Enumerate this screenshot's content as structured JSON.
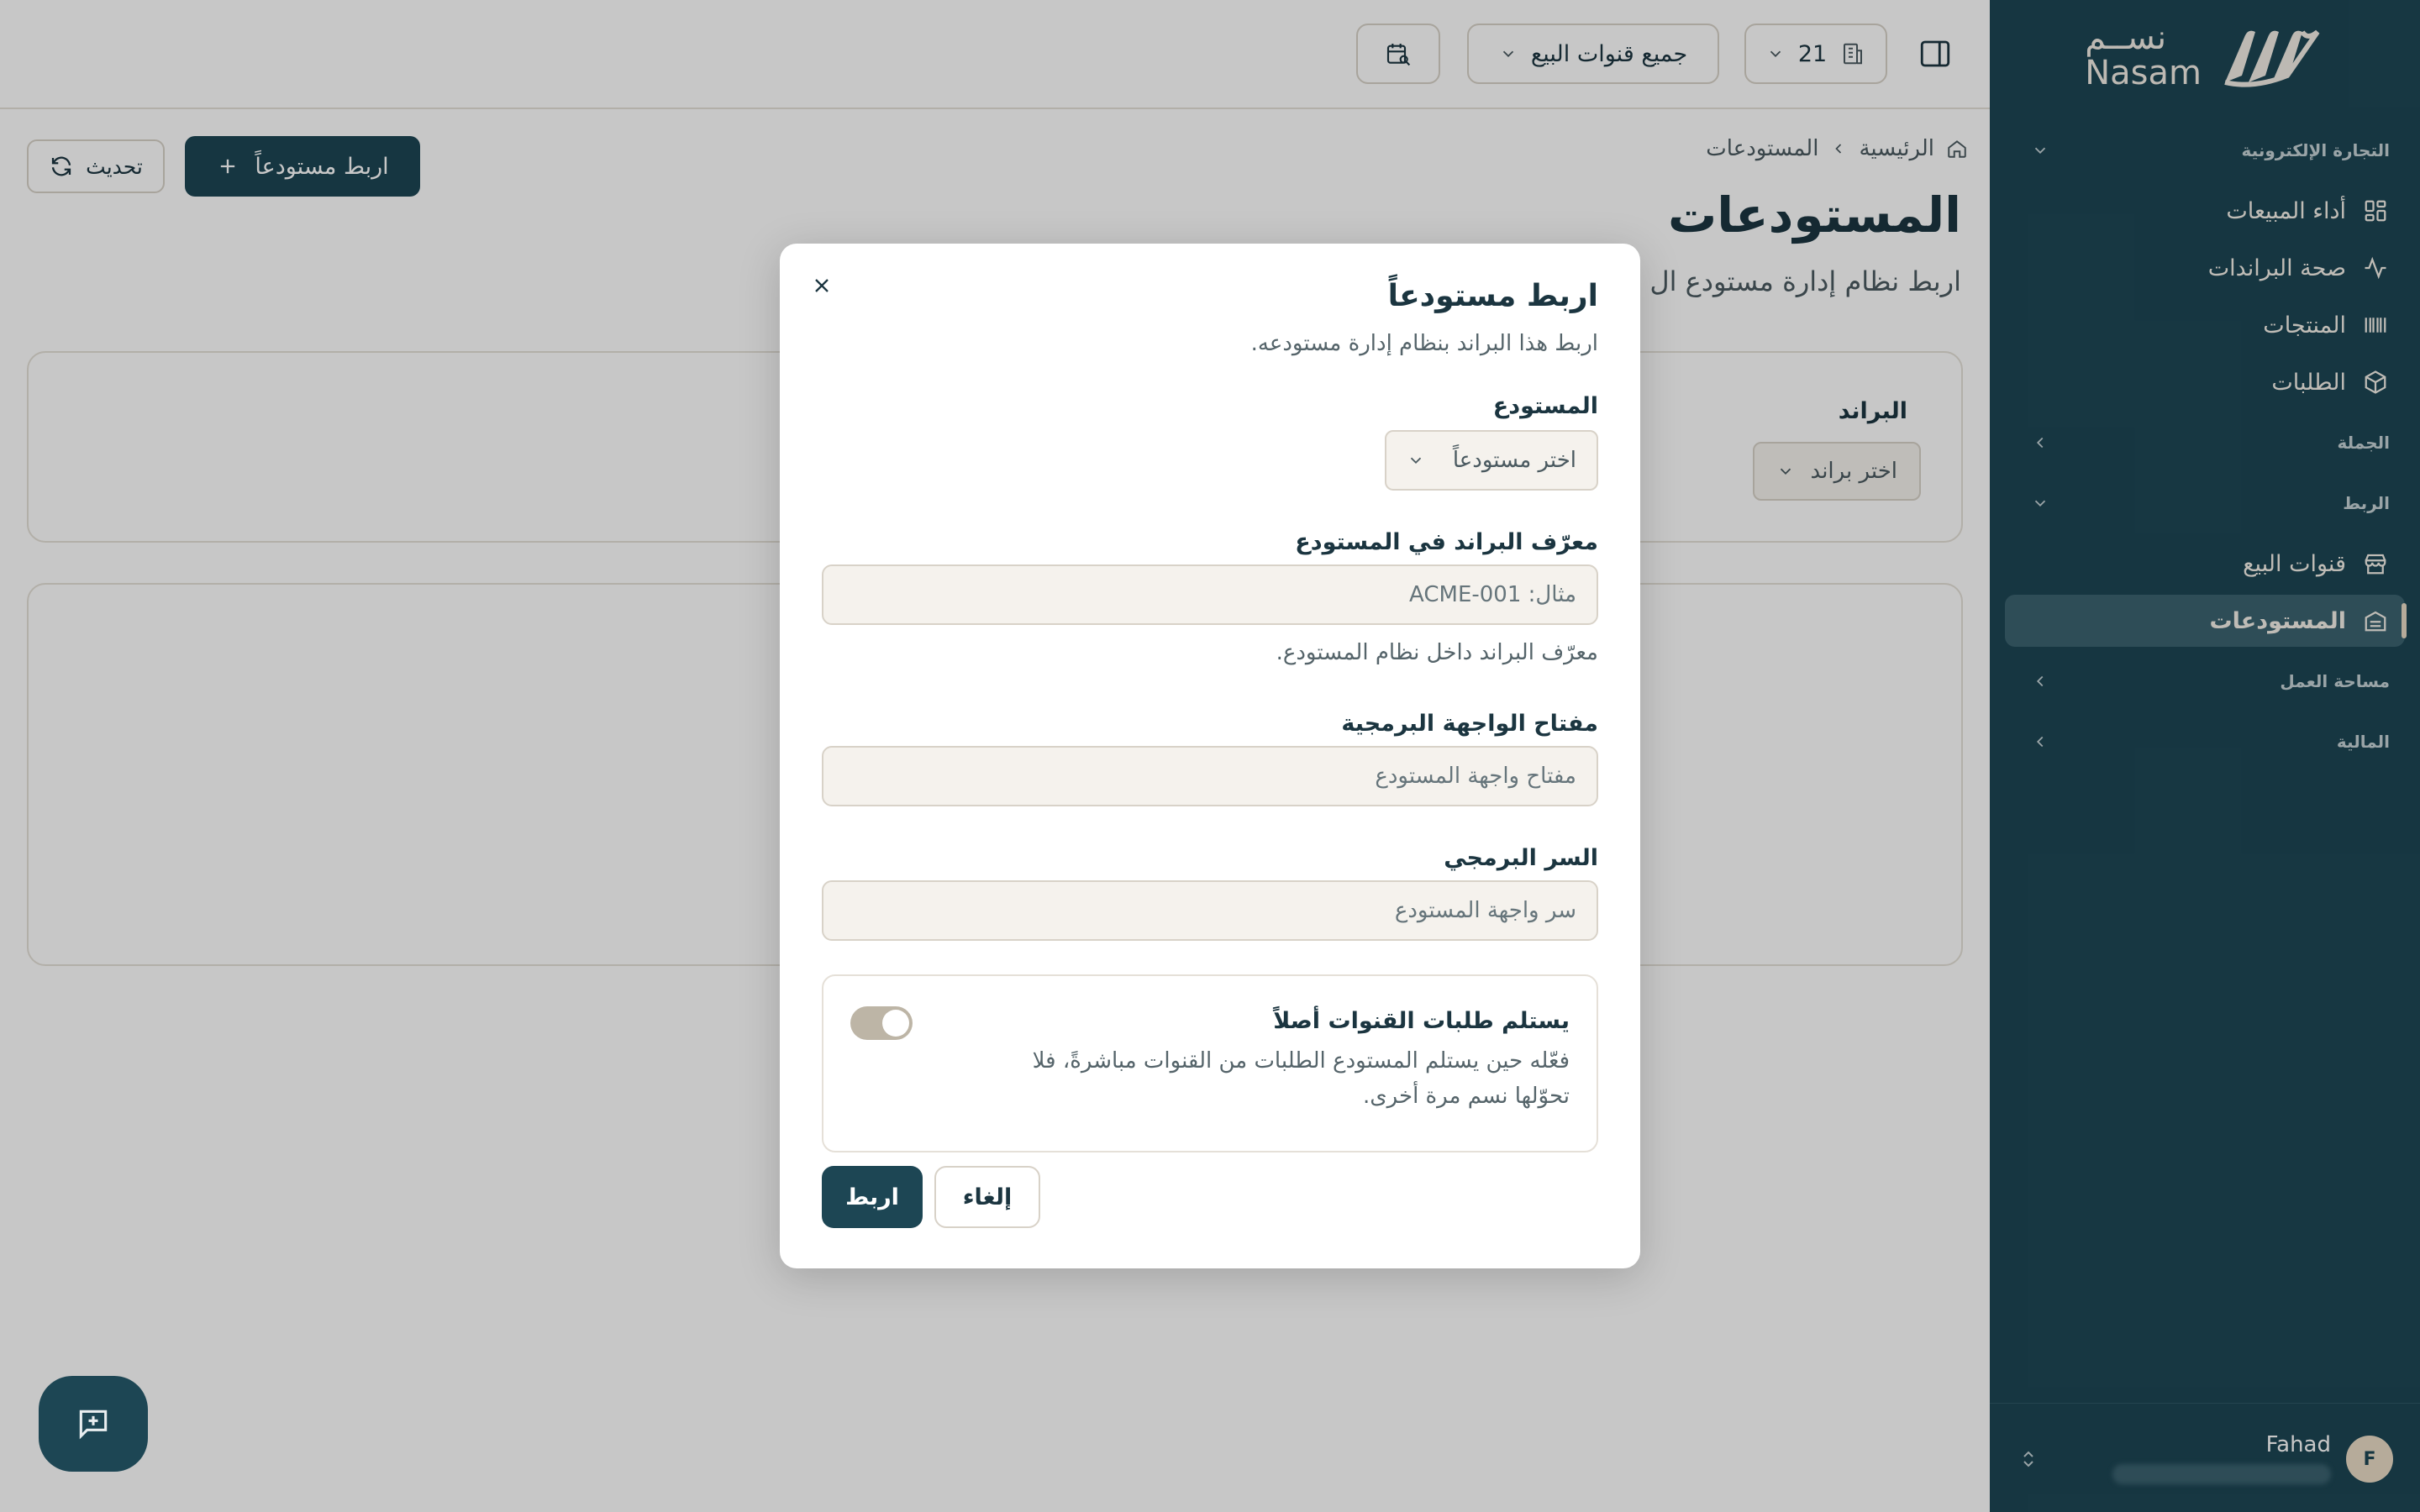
{
  "sidebar": {
    "logo_ar": "نســم",
    "logo_en": "Nasam",
    "sections": {
      "ecommerce": "التجارة الإلكترونية",
      "wholesale": "الجملة",
      "integration": "الربط",
      "workspace": "مساحة العمل",
      "finance": "المالية"
    },
    "items": {
      "sales_performance": "أداء المبيعات",
      "brand_health": "صحة البراندات",
      "products": "المنتجات",
      "orders": "الطلبات",
      "sales_channels": "قنوات البيع",
      "warehouses": "المستودعات"
    },
    "user": {
      "initial": "F",
      "name": "Fahad"
    }
  },
  "topbar": {
    "brand_count": "21",
    "channels_select": "جميع قنوات البيع"
  },
  "page": {
    "breadcrumb_home": "الرئيسية",
    "breadcrumb_current": "المستودعات",
    "title": "المستودعات",
    "subtitle": "اربط نظام إدارة مستودع ال",
    "connect_button": "اربط مستودعاً",
    "refresh_button": "تحديث",
    "filter_label": "البراند",
    "filter_placeholder": "اختر براند"
  },
  "modal": {
    "title": "اربط مستودعاً",
    "description": "اربط هذا البراند بنظام إدارة مستودعه.",
    "warehouse_label": "المستودع",
    "warehouse_placeholder": "اختر مستودعاً",
    "brand_id_label": "معرّف البراند في المستودع",
    "brand_id_placeholder": "مثال: ACME-001",
    "brand_id_hint": "معرّف البراند داخل نظام المستودع.",
    "api_key_label": "مفتاح الواجهة البرمجية",
    "api_key_placeholder": "مفتاح واجهة المستودع",
    "api_secret_label": "السر البرمجي",
    "api_secret_placeholder": "سر واجهة المستودع",
    "toggle_title": "يستلم طلبات القنوات أصلاً",
    "toggle_desc": "فعّله حين يستلم المستودع الطلبات من القنوات مباشرةً، فلا تحوّلها نسم مرة أخرى.",
    "toggle_on": false,
    "submit": "اربط",
    "cancel": "إلغاء"
  },
  "colors": {
    "sidebar_bg": "#1d4654",
    "accent": "#1d4654",
    "input_bg": "#f5f2ed",
    "active_item_bg": "#3c6370"
  }
}
